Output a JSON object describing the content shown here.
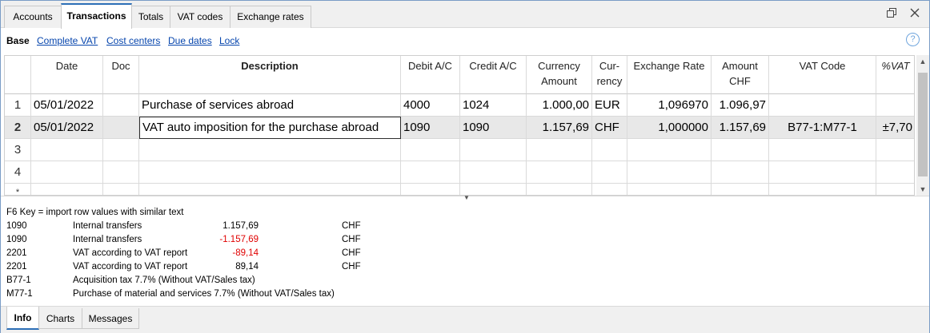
{
  "top_tabs": [
    "Accounts",
    "Transactions",
    "Totals",
    "VAT codes",
    "Exchange rates"
  ],
  "active_top_tab": "Transactions",
  "window_buttons": {
    "restore": "restore-icon",
    "close": "close-icon"
  },
  "views": [
    "Base",
    "Complete VAT",
    "Cost centers",
    "Due dates",
    "Lock"
  ],
  "active_view": "Base",
  "help_icon": "?",
  "columns": {
    "date": "Date",
    "doc": "Doc",
    "description": "Description",
    "debit_line1": "Debit A/C",
    "credit_line1": "Credit A/C",
    "currency_amount_line1": "Currency",
    "currency_amount_line2": "Amount",
    "currency_line1": "Cur-",
    "currency_line2": "rency",
    "exchange_rate": "Exchange Rate",
    "amount_chf_line1": "Amount",
    "amount_chf_line2": "CHF",
    "vat_code": "VAT Code",
    "vat_pct": "%VAT"
  },
  "rows": [
    {
      "num": "1",
      "date": "05/01/2022",
      "doc": "",
      "description": "Purchase of services abroad",
      "debit": "4000",
      "credit": "1024",
      "currency_amount": "1.000,00",
      "currency": "EUR",
      "exchange_rate": "1,096970",
      "amount_chf": "1.096,97",
      "vat_code": "",
      "vat_pct": ""
    },
    {
      "num": "2",
      "date": "05/01/2022",
      "doc": "",
      "description": "VAT auto imposition for the purchase abroad",
      "debit": "1090",
      "credit": "1090",
      "currency_amount": "1.157,69",
      "currency": "CHF",
      "exchange_rate": "1,000000",
      "amount_chf": "1.157,69",
      "vat_code": "B77-1:M77-1",
      "vat_pct": "±7,70"
    },
    {
      "num": "3"
    },
    {
      "num": "4"
    },
    {
      "num": "*"
    }
  ],
  "info": {
    "hint": "F6 Key = import row values with similar text",
    "lines": [
      {
        "account": "1090",
        "description": "Internal transfers",
        "amount": "1.157,69",
        "negative": false,
        "currency": "CHF"
      },
      {
        "account": "1090",
        "description": "Internal transfers",
        "amount": "-1.157,69",
        "negative": true,
        "currency": "CHF"
      },
      {
        "account": "2201",
        "description": "VAT according to VAT report",
        "amount": "-89,14",
        "negative": true,
        "currency": "CHF"
      },
      {
        "account": "2201",
        "description": "VAT according to VAT report",
        "amount": "89,14",
        "negative": false,
        "currency": "CHF"
      },
      {
        "account": "B77-1",
        "description": "Acquisition tax 7.7% (Without VAT/Sales tax)",
        "amount": "",
        "negative": false,
        "currency": ""
      },
      {
        "account": "M77-1",
        "description": "Purchase of material and services 7.7% (Without VAT/Sales tax)",
        "amount": "",
        "negative": false,
        "currency": ""
      }
    ]
  },
  "bottom_tabs": [
    "Info",
    "Charts",
    "Messages"
  ],
  "active_bottom_tab": "Info",
  "colors": {
    "accent": "#2c6fb7",
    "link": "#0645ad",
    "negative": "#e00000",
    "selected_row": "#e8e8e8"
  }
}
